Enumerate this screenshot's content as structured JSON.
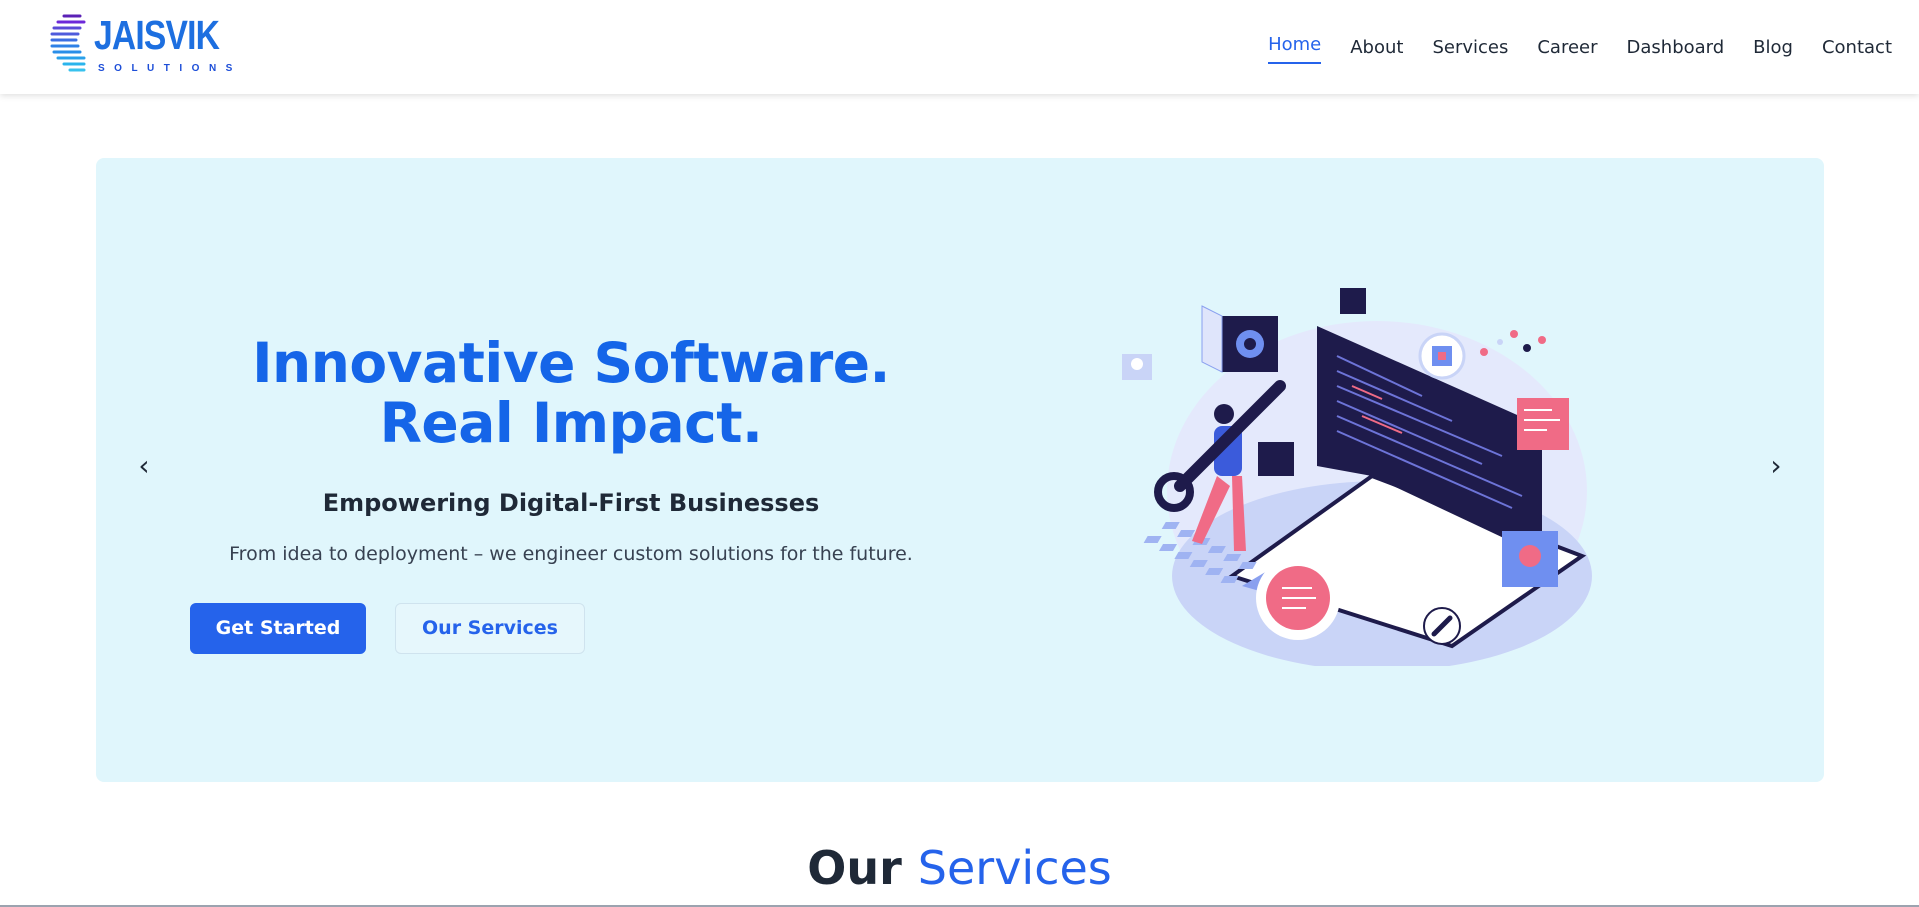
{
  "brand": {
    "name": "JAISVIK",
    "tagline": "SOLUTIONS",
    "logo_icon": "globe-lines-icon",
    "color": "#1d6fe0"
  },
  "nav": {
    "items": [
      {
        "label": "Home",
        "active": true
      },
      {
        "label": "About",
        "active": false
      },
      {
        "label": "Services",
        "active": false
      },
      {
        "label": "Career",
        "active": false
      },
      {
        "label": "Dashboard",
        "active": false
      },
      {
        "label": "Blog",
        "active": false
      },
      {
        "label": "Contact",
        "active": false
      }
    ],
    "active_color": "#2563eb"
  },
  "hero": {
    "title_line1": "Innovative Software.",
    "title_line2": "Real Impact.",
    "subtitle": "Empowering Digital-First Businesses",
    "description": "From idea to deployment – we engineer custom solutions for the future.",
    "primary_button": "Get Started",
    "secondary_button": "Our Services",
    "prev_arrow": "‹",
    "next_arrow": "›",
    "background": "#e0f6fc",
    "title_color": "#1565e8",
    "illustration": "developer-with-wrench-and-laptop-illustration"
  },
  "services_section": {
    "heading_part1": "Our",
    "heading_part2": "Services"
  }
}
